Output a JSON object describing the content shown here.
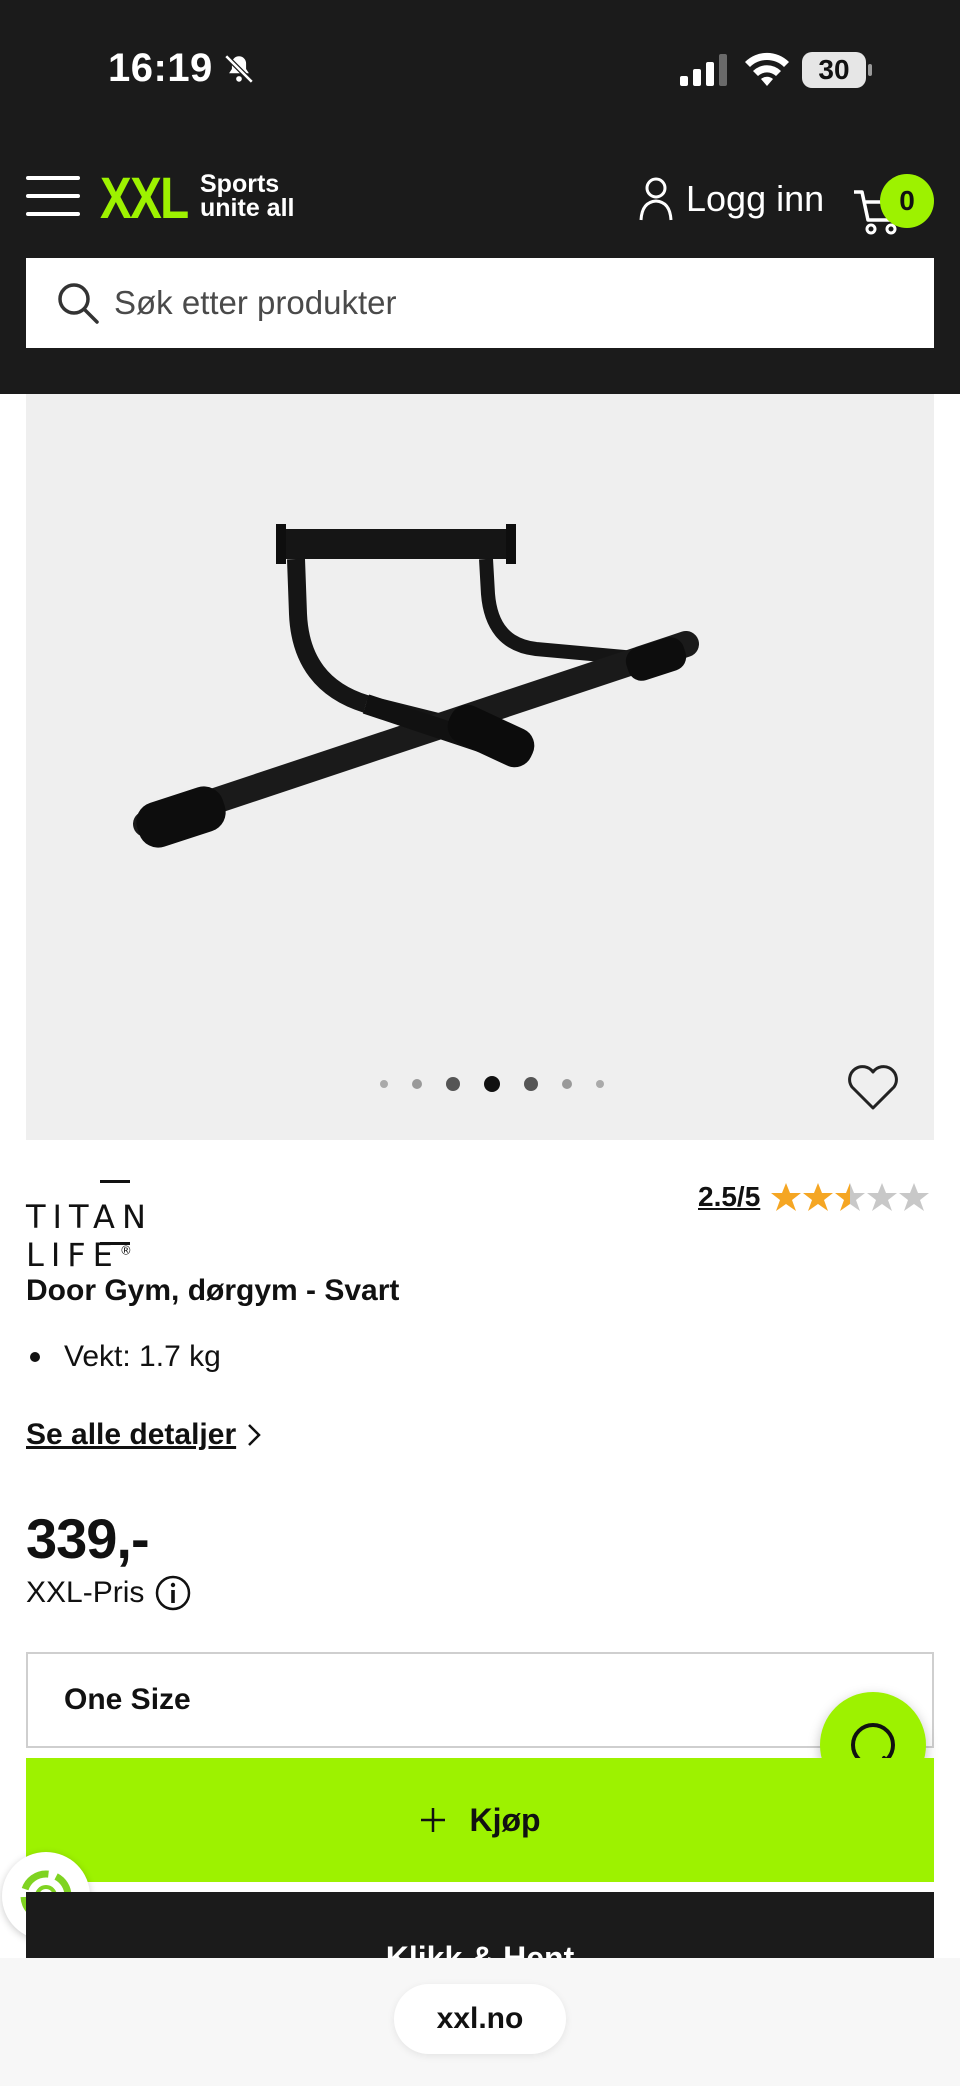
{
  "status_bar": {
    "time": "16:19",
    "battery": "30"
  },
  "header": {
    "logo_mark": "XXL",
    "logo_tagline_1": "Sports",
    "logo_tagline_2": "unite all",
    "login_label": "Logg inn",
    "cart_count": "0",
    "search_placeholder": "Søk etter produkter"
  },
  "gallery": {
    "image_count": 7,
    "active_index": 3
  },
  "product": {
    "brand": "TITAN LIFE",
    "brand_mark": "®",
    "rating_text": "2.5/5",
    "rating_value": 2.5,
    "rating_max": 5,
    "title": "Door Gym, dørgym - Svart",
    "bullets": [
      "Vekt: 1.7 kg"
    ],
    "details_link": "Se alle detaljer",
    "price": "339,-",
    "price_label": "XXL-Pris",
    "size_value": "One Size",
    "buy_label": "Kjøp",
    "click_collect_label": "Klikk & Hent"
  },
  "browser": {
    "url": "xxl.no"
  },
  "colors": {
    "accent": "#9df200",
    "dark": "#1b1b1b",
    "star": "#f5a623"
  }
}
